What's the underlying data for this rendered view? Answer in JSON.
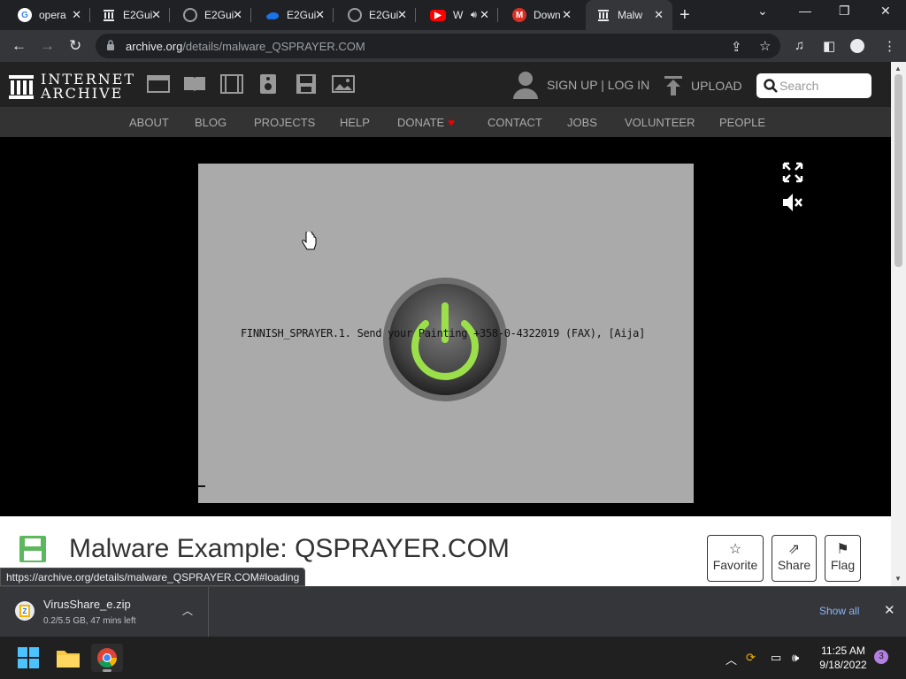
{
  "browser": {
    "tabs": [
      {
        "title": "opera",
        "favicon": "google-g-icon",
        "color": "#4285f4"
      },
      {
        "title": "E2Gui",
        "favicon": "archive-temple-icon",
        "color": "#e8eaed"
      },
      {
        "title": "E2Gui",
        "favicon": "globe-icon",
        "color": "#9aa0a6"
      },
      {
        "title": "E2Gui",
        "favicon": "onedrive-cloud-icon",
        "color": "#1a73e8"
      },
      {
        "title": "E2Gui",
        "favicon": "globe-icon",
        "color": "#9aa0a6"
      },
      {
        "title": "W",
        "favicon": "youtube-icon",
        "color": "#ff0000"
      },
      {
        "title": "Down",
        "favicon": "m-icon",
        "color": "#d93025"
      },
      {
        "title": "Malw",
        "favicon": "archive-temple-icon",
        "color": "#e8eaed"
      }
    ],
    "url_host": "archive.org",
    "url_path": "/details/malware_QSPRAYER.COM",
    "status_url": "https://archive.org/details/malware_QSPRAYER.COM#loading"
  },
  "ia": {
    "logo_line1": "INTERNET",
    "logo_line2": "ARCHIVE",
    "signin_label": "SIGN UP | LOG IN",
    "upload_label": "UPLOAD",
    "search_placeholder": "Search",
    "nav": [
      "ABOUT",
      "BLOG",
      "PROJECTS",
      "HELP",
      "DONATE",
      "CONTACT",
      "JOBS",
      "VOLUNTEER",
      "PEOPLE"
    ],
    "donate_heart": "♥"
  },
  "emulator": {
    "message": "FINNISH_SPRAYER.1. Send your Painting +358-0-4322019 (FAX), [Aija]",
    "power_color": "#9be04a"
  },
  "item": {
    "title": "Malware Example: QSPRAYER.COM",
    "actions": [
      {
        "label": "Favorite",
        "icon": "star-icon"
      },
      {
        "label": "Share",
        "icon": "share-icon"
      },
      {
        "label": "Flag",
        "icon": "flag-icon"
      }
    ],
    "disk_color": "#5cb85c"
  },
  "download": {
    "filename": "VirusShare_e.zip",
    "status": "0.2/5.5 GB, 47 mins left",
    "show_all": "Show all"
  },
  "taskbar": {
    "time": "11:25 AM",
    "date": "9/18/2022",
    "notification_count": "3"
  }
}
